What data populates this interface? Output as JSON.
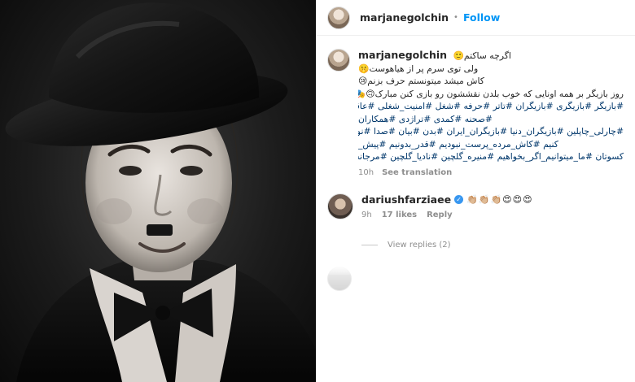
{
  "post": {
    "author": "marjanegolchin",
    "follow_label": "Follow",
    "dot": "•"
  },
  "caption": {
    "author": "marjanegolchin",
    "lines": [
      "اگرچه ساکتم🙂",
      "ولی توی سرم پر از هیاهوست🤫",
      "کاش میشد میتونستم حرف بزنم😢",
      "روز بازیگر بر همه اونایی که خوب بلدن نقششون رو بازی کنن مبارک🙃🎭🎬",
      "#بازیگر #بازیگری #بازیگران #تاتر #حرفه #شغل #امنیت_شغلی #عاقبت_این_کار #سینما",
      "#صحنه #کمدی #تراژدی #همکاران",
      "#چارلی_چاپلین #بازیگران_دنیا #بازیگران_ایران #بدن #بیان #صدا #نو_شدن #شروع_",
      "کنیم #کاش_مرده_پرست_نبودیم #قدر_بدونیم #پیش_",
      "کسوتان #ما_میتوانیم_اگر_بخواهیم #منیره_گلچین #نادیا_گلچین #مرجانه_گلچین"
    ],
    "time": "10h",
    "see_translation": "See translation"
  },
  "comment": {
    "author": "dariushfarziaee",
    "verified_glyph": "✓",
    "emojis": "👏🏼👏🏼👏🏼😍😍😍",
    "time": "9h",
    "likes": "17 likes",
    "reply": "Reply"
  },
  "view_replies": "View replies (2)"
}
